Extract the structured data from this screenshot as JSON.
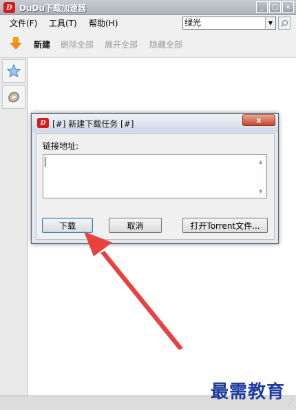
{
  "window": {
    "title": "DuDu下载加速器",
    "logo_text": "D",
    "minimize": "_",
    "maximize": "□",
    "close": "×"
  },
  "menu": {
    "file": "文件(F)",
    "tools": "工具(T)",
    "help": "帮助(H)"
  },
  "search": {
    "selected_value": "绿光",
    "arrow": "▼",
    "button_icon": "magnifier-icon"
  },
  "toolbar": {
    "new": "新建",
    "delete_all": "删除全部",
    "expand_all": "展开全部",
    "hide_all": "隐藏全部"
  },
  "sidebar": {
    "download_icon": "download-arrow-icon",
    "favorites_icon": "star-icon",
    "ring_icon": "ring-icon"
  },
  "dialog": {
    "title": "[#] 新建下载任务 [#]",
    "close": "x",
    "url_label": "链接地址:",
    "url_value": "",
    "download_button": "下载",
    "cancel_button": "取消",
    "torrent_button": "打开Torrent文件..."
  },
  "watermark": "最需教育",
  "colors": {
    "annotation_arrow": "#e8413f",
    "logo_red": "#d91a1a",
    "watermark_blue": "#1e3ca0"
  }
}
